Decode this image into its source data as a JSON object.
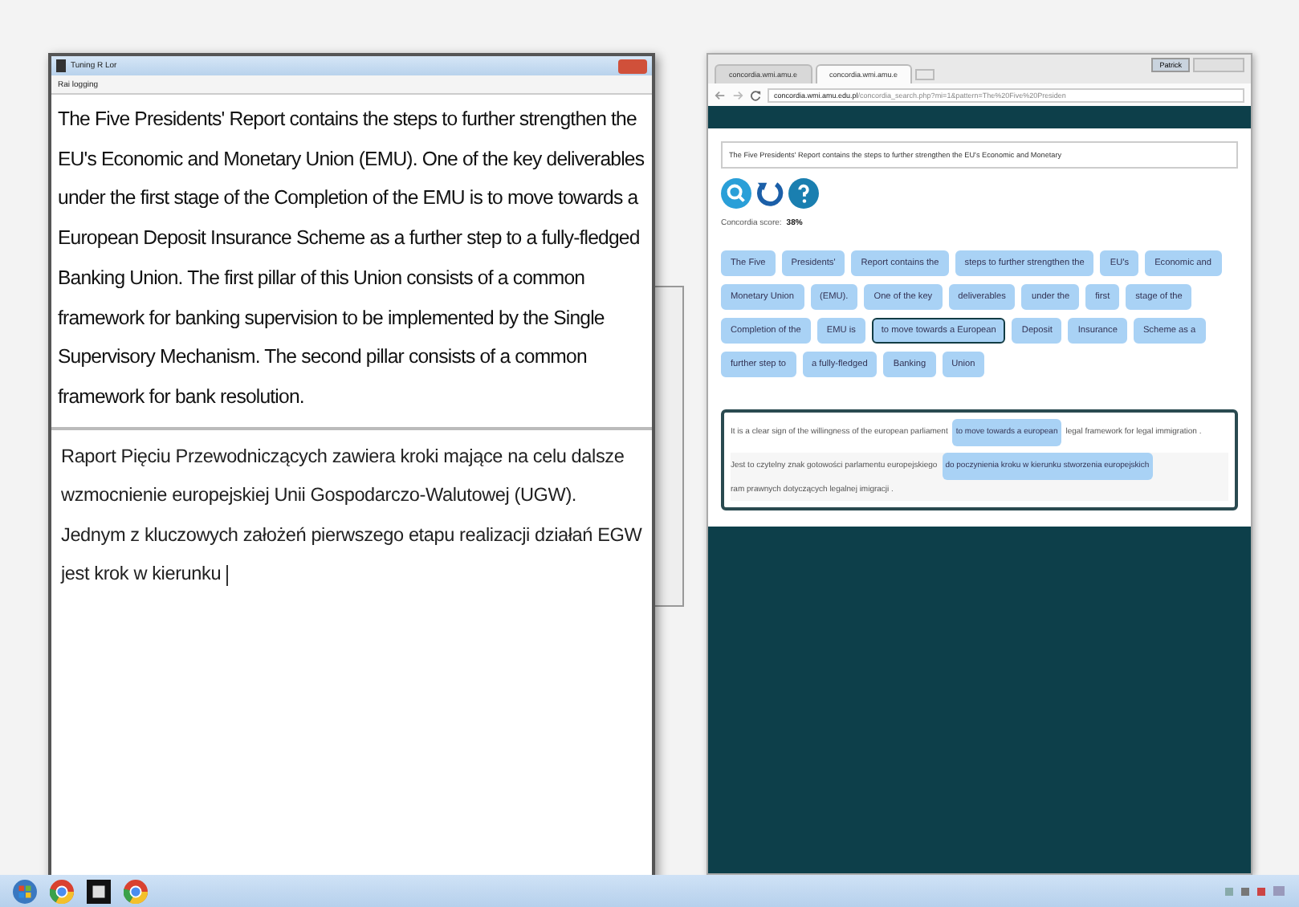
{
  "editor_window": {
    "title": "Tuning R Lor",
    "menu": [
      "Rai logging"
    ],
    "source_text": "The Five Presidents' Report contains the steps to further strengthen the EU's Economic and Monetary Union (EMU). One of the key deliverables under the first stage of the Completion of the EMU is to move towards a European Deposit Insurance Scheme as a further step to a fully-fledged Banking Union. The first pillar of this Union consists of a common framework for banking supervision to be implemented by the Single Supervisory Mechanism. The second pillar consists of a common framework for bank resolution.",
    "target_text": "Raport Pięciu Przewodniczących zawiera kroki mające na celu dalsze wzmocnienie europejskiej Unii Gospodarczo-Walutowej (UGW). Jednym z kluczowych założeń pierwszego etapu realizacji działań EGW jest krok w kierunku"
  },
  "browser": {
    "tabs": [
      {
        "label": "concordia.wmi.amu.e",
        "selected": false
      },
      {
        "label": "concordia.wmi.amu.e",
        "selected": true
      }
    ],
    "profile": "Patrick",
    "address": {
      "host": "concordia.wmi.amu.edu.pl",
      "path": "/concordia_search.php?mi=1&pattern=The%20Five%20Presiden"
    },
    "query": "The Five Presidents' Report contains the steps to further strengthen the EU's Economic and Monetary",
    "score_label": "Concordia score:",
    "score": "38%",
    "chips": [
      {
        "label": "The Five",
        "selected": false
      },
      {
        "label": "Presidents'",
        "selected": false
      },
      {
        "label": "Report contains the",
        "selected": false
      },
      {
        "label": "steps to further strengthen the",
        "selected": false
      },
      {
        "label": "EU's",
        "selected": false
      },
      {
        "label": "Economic and",
        "selected": false
      },
      {
        "label": "Monetary Union",
        "selected": false
      },
      {
        "label": "(EMU).",
        "selected": false
      },
      {
        "label": "One of the key",
        "selected": false
      },
      {
        "label": "deliverables",
        "selected": false
      },
      {
        "label": "under the",
        "selected": false
      },
      {
        "label": "first",
        "selected": false
      },
      {
        "label": "stage of the",
        "selected": false
      },
      {
        "label": "Completion of the",
        "selected": false
      },
      {
        "label": "EMU is",
        "selected": false
      },
      {
        "label": "to move towards a European",
        "selected": true
      },
      {
        "label": "Deposit",
        "selected": false
      },
      {
        "label": "Insurance",
        "selected": false
      },
      {
        "label": "Scheme as a",
        "selected": false
      },
      {
        "label": "further step to",
        "selected": false
      },
      {
        "label": "a fully-fledged",
        "selected": false
      },
      {
        "label": "Banking",
        "selected": false
      },
      {
        "label": "Union",
        "selected": false
      }
    ],
    "example": [
      [
        {
          "text": "It is a clear sign of the willingness of the european parliament",
          "highlight": false
        },
        {
          "text": "to move towards a european",
          "highlight": true
        },
        {
          "text": "legal framework for legal immigration .",
          "highlight": false
        }
      ],
      [
        {
          "text": "Jest to czytelny znak gotowości parlamentu europejskiego",
          "highlight": false
        },
        {
          "text": "do poczynienia kroku w kierunku stworzenia europejskich",
          "highlight": true
        },
        {
          "text": "ram prawnych dotyczących legalnej imigracji .",
          "highlight": false
        }
      ]
    ]
  }
}
